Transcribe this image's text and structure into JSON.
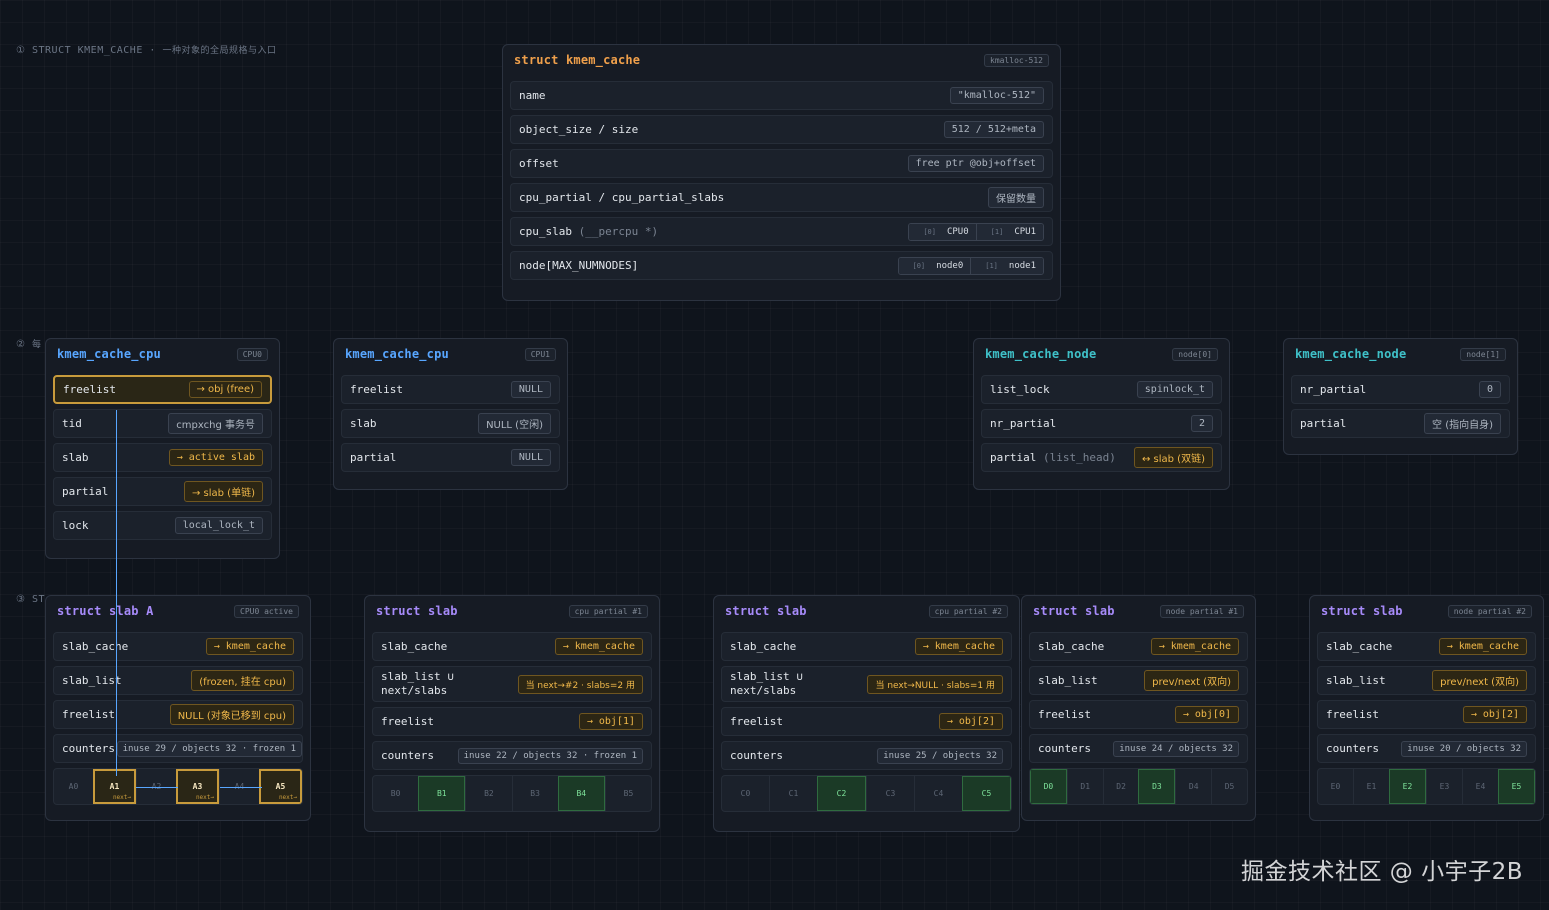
{
  "labels": {
    "s1_num": "①",
    "s1_text": "STRUCT KMEM_CACHE",
    "s1_sep": "·",
    "s1_cn": "一种对象的全局规格与入口",
    "s2_num": "②",
    "s2_text": "每",
    "s3_num": "③",
    "s3_text": "ST"
  },
  "kmem_cache": {
    "title": "struct kmem_cache",
    "tag": "kmalloc-512",
    "name_field": "name",
    "name_val": "\"kmalloc-512\"",
    "size_field": "object_size / size",
    "size_val": "512 / 512+meta",
    "offset_field": "offset",
    "offset_val": "free ptr @obj+offset",
    "cpup_field": "cpu_partial / cpu_partial_slabs",
    "cpup_val": "保留数量",
    "cpuslab_field": "cpu_slab",
    "cpuslab_note": "(__percpu *)",
    "cpu0_ix": "[0]",
    "cpu0": "CPU0",
    "cpu1_ix": "[1]",
    "cpu1": "CPU1",
    "node_field": "node[MAX_NUMNODES]",
    "node0_ix": "[0]",
    "node0": "node0",
    "node1_ix": "[1]",
    "node1": "node1"
  },
  "cpu0": {
    "title": "kmem_cache_cpu",
    "tag": "CPU0",
    "rows": [
      {
        "f": "freelist",
        "v": "→ obj (free)"
      },
      {
        "f": "tid",
        "v": "cmpxchg 事务号"
      },
      {
        "f": "slab",
        "v": "→ active slab"
      },
      {
        "f": "partial",
        "v": "→ slab (单链)"
      },
      {
        "f": "lock",
        "v": "local_lock_t"
      }
    ]
  },
  "cpu1": {
    "title": "kmem_cache_cpu",
    "tag": "CPU1",
    "rows": [
      {
        "f": "freelist",
        "v": "NULL"
      },
      {
        "f": "slab",
        "v": "NULL (空闲)"
      },
      {
        "f": "partial",
        "v": "NULL"
      }
    ]
  },
  "node0": {
    "title": "kmem_cache_node",
    "tag": "node[0]",
    "rows": [
      {
        "f": "list_lock",
        "v": "spinlock_t"
      },
      {
        "f": "nr_partial",
        "v": "2"
      },
      {
        "f": "partial",
        "note": "(list_head)",
        "v": "↔ slab (双链)"
      }
    ]
  },
  "node1": {
    "title": "kmem_cache_node",
    "tag": "node[1]",
    "rows": [
      {
        "f": "nr_partial",
        "v": "0"
      },
      {
        "f": "partial",
        "v": "空 (指向自身)"
      }
    ]
  },
  "slabA": {
    "title": "struct slab A",
    "tag": "CPU0 active",
    "rows": [
      {
        "f": "slab_cache",
        "v": "→ kmem_cache"
      },
      {
        "f": "slab_list",
        "v": "(frozen, 挂在 cpu)"
      },
      {
        "f": "freelist",
        "v": "NULL (对象已移到 cpu)"
      },
      {
        "f": "counters",
        "v": "inuse 29 / objects 32 · frozen 1"
      }
    ],
    "objs": [
      "A0",
      "A1",
      "A2",
      "A3",
      "A4",
      "A5"
    ],
    "next": "next→"
  },
  "slabB": {
    "title": "struct slab",
    "tag": "cpu partial #1",
    "rows": [
      {
        "f": "slab_cache",
        "v": "→ kmem_cache"
      },
      {
        "f": "slab_list ∪",
        "f2": "next/slabs",
        "v": "当 next→#2 · slabs=2 用"
      },
      {
        "f": "freelist",
        "v": "→ obj[1]"
      },
      {
        "f": "counters",
        "v": "inuse 22 / objects 32 · frozen 1"
      }
    ],
    "objs": [
      "B0",
      "B1",
      "B2",
      "B3",
      "B4",
      "B5"
    ]
  },
  "slabC": {
    "title": "struct slab",
    "tag": "cpu partial #2",
    "rows": [
      {
        "f": "slab_cache",
        "v": "→ kmem_cache"
      },
      {
        "f": "slab_list ∪",
        "f2": "next/slabs",
        "v": "当 next→NULL · slabs=1 用"
      },
      {
        "f": "freelist",
        "v": "→ obj[2]"
      },
      {
        "f": "counters",
        "v": "inuse 25 / objects 32"
      }
    ],
    "objs": [
      "C0",
      "C1",
      "C2",
      "C3",
      "C4",
      "C5"
    ]
  },
  "slabD": {
    "title": "struct slab",
    "tag": "node partial #1",
    "rows": [
      {
        "f": "slab_cache",
        "v": "→ kmem_cache"
      },
      {
        "f": "slab_list",
        "v": "prev/next (双向)"
      },
      {
        "f": "freelist",
        "v": "→ obj[0]"
      },
      {
        "f": "counters",
        "v": "inuse 24 / objects 32"
      }
    ],
    "objs": [
      "D0",
      "D1",
      "D2",
      "D3",
      "D4",
      "D5"
    ]
  },
  "slabE": {
    "title": "struct slab",
    "tag": "node partial #2",
    "rows": [
      {
        "f": "slab_cache",
        "v": "→ kmem_cache"
      },
      {
        "f": "slab_list",
        "v": "prev/next (双向)"
      },
      {
        "f": "freelist",
        "v": "→ obj[2]"
      },
      {
        "f": "counters",
        "v": "inuse 20 / objects 32"
      }
    ],
    "objs": [
      "E0",
      "E1",
      "E2",
      "E3",
      "E4",
      "E5"
    ]
  },
  "watermark": "掘金技术社区 @ 小宇子2B"
}
